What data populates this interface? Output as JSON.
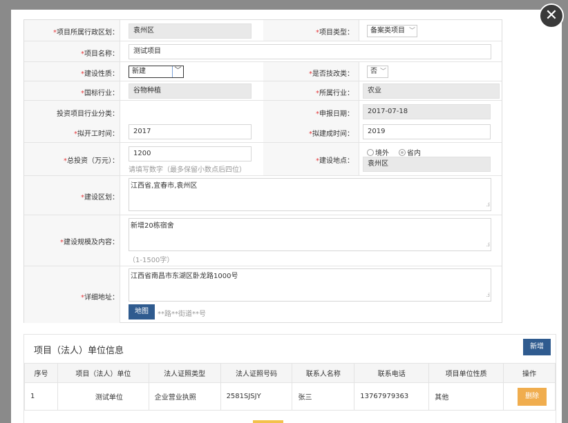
{
  "close_glyph": "✕",
  "form": {
    "admin_area": {
      "label": "项目所属行政区划：",
      "value": "袁州区"
    },
    "project_type": {
      "label": "项目类型：",
      "value": "备案类项目"
    },
    "project_name": {
      "label": "项目名称：",
      "value": "测试项目"
    },
    "build_nature": {
      "label": "建设性质：",
      "value": "新建"
    },
    "is_tech_reform": {
      "label": "是否技改类：",
      "value": "否"
    },
    "national_industry": {
      "label": "国标行业：",
      "value": "谷物种植"
    },
    "industry": {
      "label": "所属行业：",
      "value": "农业"
    },
    "invest_category": {
      "label": "投资项目行业分类："
    },
    "report_date": {
      "label": "申报日期：",
      "value": "2017-07-18"
    },
    "start_time": {
      "label": "拟开工时间：",
      "value": "2017"
    },
    "finish_time": {
      "label": "拟建成时间：",
      "value": "2019"
    },
    "total_invest": {
      "label": "总投资（万元）：",
      "value": "1200",
      "hint": "请填写数字（最多保留小数点后四位）"
    },
    "location": {
      "label": "建设地点：",
      "opt_outside": "境外",
      "opt_inside": "省内",
      "value": "袁州区"
    },
    "build_area": {
      "label": "建设区划：",
      "value": "江西省,宜春市,袁州区"
    },
    "scale_content": {
      "label": "建设规模及内容：",
      "value": "新增20栋宿舍",
      "hint": "（1-1500字）"
    },
    "address": {
      "label": "详细地址：",
      "value": "江西省南昌市东湖区卧龙路1000号",
      "map_button": "地图",
      "hint": "**路**街道**号"
    },
    "required_mark": "*"
  },
  "unit_section": {
    "title": "项目（法人）单位信息",
    "add_button": "新增",
    "columns": [
      "序号",
      "项目（法人）单位",
      "法人证照类型",
      "法人证照号码",
      "联系人名称",
      "联系电话",
      "项目单位性质",
      "操作"
    ],
    "rows": [
      {
        "no": "1",
        "unit": "测试单位",
        "cert_type": "企业营业执照",
        "cert_no": "2581SJSJY",
        "contact": "张三",
        "phone": "13767979363",
        "nature": "其他",
        "action": "删除"
      }
    ]
  },
  "icons": {
    "close": "close-icon",
    "dropdown": "chevron-down-icon",
    "resize": "resize-grip-icon"
  },
  "colors": {
    "primary_button": "#2f5b8f",
    "delete_button": "#f0ad4e",
    "required": "#e4393c"
  }
}
